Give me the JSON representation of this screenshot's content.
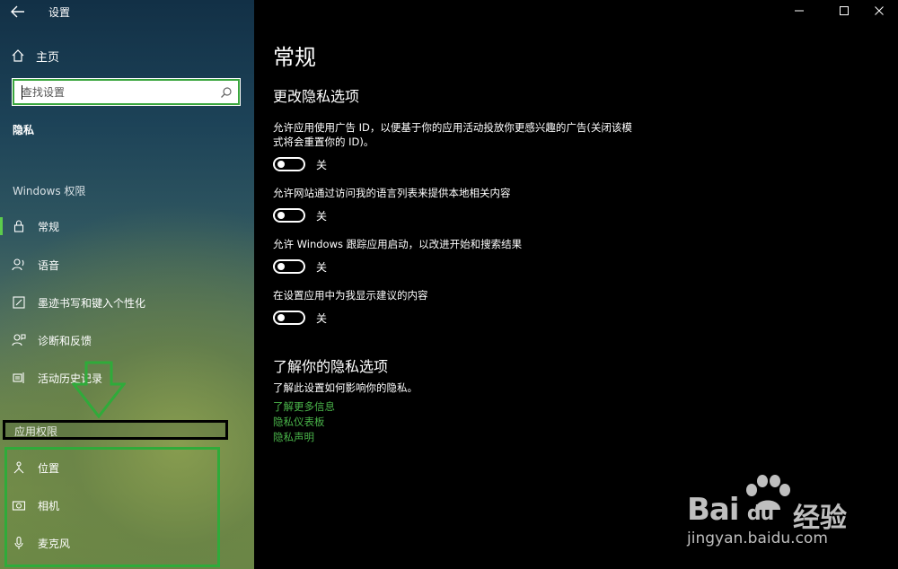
{
  "window": {
    "title": "设置",
    "controls": [
      "minimize-icon",
      "maximize-icon",
      "close-icon"
    ]
  },
  "sidebar": {
    "home_label": "主页",
    "search": {
      "placeholder": "查找设置"
    },
    "current_section": "隐私",
    "windows_permissions_header": "Windows 权限",
    "windows_items": [
      {
        "label": "常规",
        "icon": "lock-icon",
        "active": true
      },
      {
        "label": "语音",
        "icon": "speech-icon"
      },
      {
        "label": "墨迹书写和键入个性化",
        "icon": "pen-icon"
      },
      {
        "label": "诊断和反馈",
        "icon": "feedback-icon"
      },
      {
        "label": "活动历史记录",
        "icon": "timeline-icon"
      }
    ],
    "app_permissions_header": "应用权限",
    "app_items": [
      {
        "label": "位置",
        "icon": "location-icon"
      },
      {
        "label": "相机",
        "icon": "camera-icon"
      },
      {
        "label": "麦克风",
        "icon": "microphone-icon"
      }
    ]
  },
  "main": {
    "page_title": "常规",
    "section1_title": "更改隐私选项",
    "settings": [
      {
        "description": "允许应用使用广告 ID，以便基于你的应用活动投放你更感兴趣的广告(关闭该模式将会重置你的 ID)。",
        "state": "关",
        "on": false
      },
      {
        "description": "允许网站通过访问我的语言列表来提供本地相关内容",
        "state": "关",
        "on": false
      },
      {
        "description": "允许 Windows 跟踪应用启动，以改进开始和搜索结果",
        "state": "关",
        "on": false
      },
      {
        "description": "在设置应用中为我显示建议的内容",
        "state": "关",
        "on": false
      }
    ],
    "section2_title": "了解你的隐私选项",
    "section2_desc": "了解此设置如何影响你的隐私。",
    "links": [
      "了解更多信息",
      "隐私仪表板",
      "隐私声明"
    ]
  },
  "watermark": {
    "brand_latin": "Bai",
    "brand_du": "du",
    "brand_cn": "经验",
    "url": "jingyan.baidu.com"
  },
  "colors": {
    "accent_green": "#3aa63e",
    "link_green": "#4ab54a",
    "active_indicator": "#5ccc4c",
    "main_background": "#000000"
  }
}
